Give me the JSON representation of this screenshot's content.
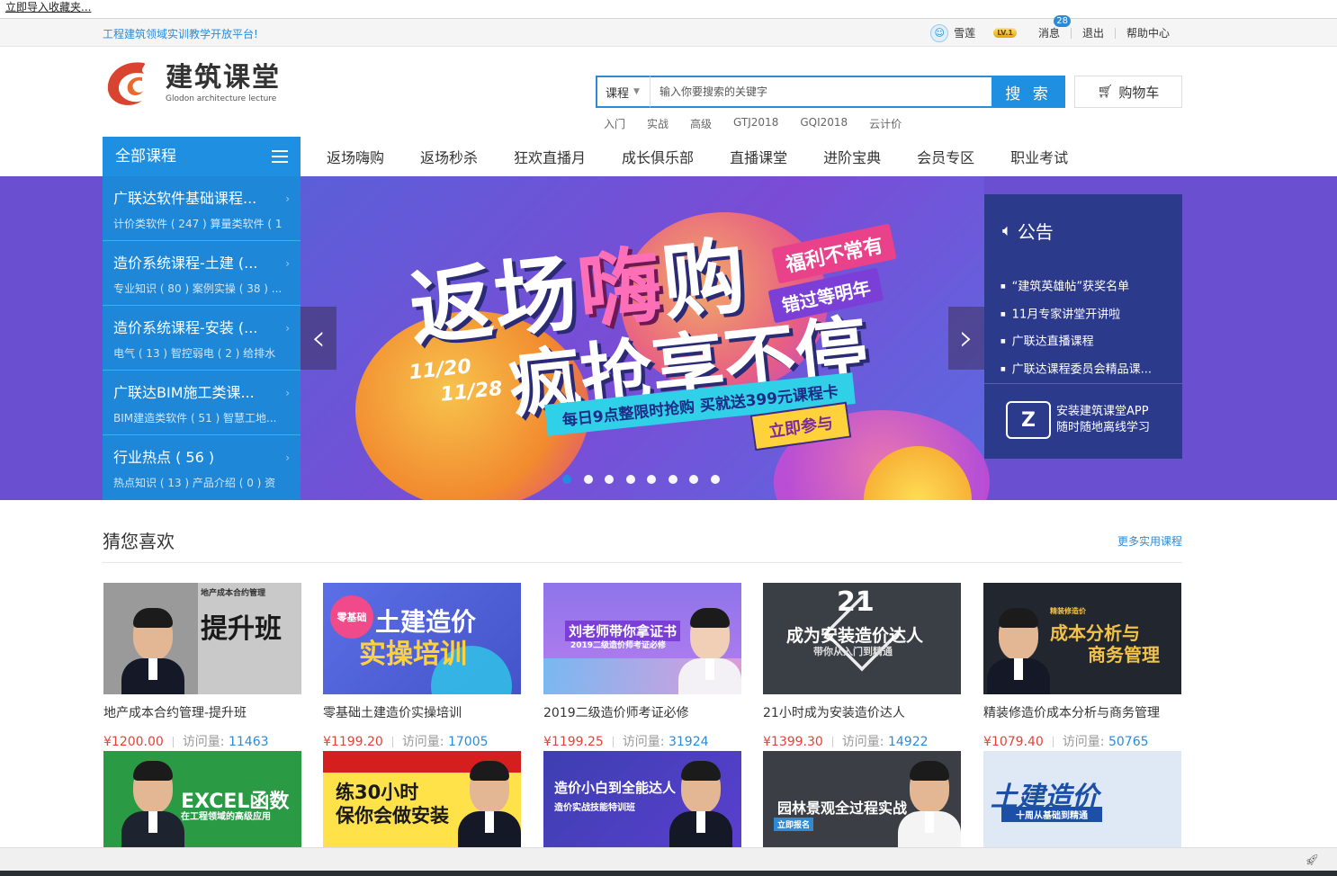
{
  "bookmark": {
    "label": "立即导入收藏夹..."
  },
  "topbar": {
    "slogan": "工程建筑领域实训教学开放平台!",
    "username": "雪莲",
    "level": "LV.1",
    "messages_label": "消息",
    "messages_count": "28",
    "logout": "退出",
    "help": "帮助中心"
  },
  "header": {
    "logo_cn": "建筑课堂",
    "logo_en": "Glodon architecture lecture",
    "search_scope": "课程",
    "search_placeholder": "输入你要搜索的关键字",
    "search_button": "搜 索",
    "cart": "购物车",
    "hotwords": [
      "入门",
      "实战",
      "高级",
      "GTJ2018",
      "GQI2018",
      "云计价"
    ]
  },
  "nav": {
    "all_courses": "全部课程",
    "items": [
      "返场嗨购",
      "返场秒杀",
      "狂欢直播月",
      "成长俱乐部",
      "直播课堂",
      "进阶宝典",
      "会员专区",
      "职业考试"
    ]
  },
  "categories": [
    {
      "title": "广联达软件基础课程...",
      "sub": "计价类软件 ( 247 )   算量类软件 ( 1"
    },
    {
      "title": "造价系统课程-土建 (...",
      "sub": "专业知识 ( 80 )   案例实操 ( 38 ) ..."
    },
    {
      "title": "造价系统课程-安装 (...",
      "sub": "电气 ( 13 )   智控弱电 ( 2 )   给排水"
    },
    {
      "title": "广联达BIM施工类课...",
      "sub": "BIM建造类软件 ( 51 )   智慧工地..."
    },
    {
      "title": "行业热点 ( 56 )",
      "sub": "热点知识 ( 13 )   产品介绍 ( 0 )   资"
    }
  ],
  "banner": {
    "line1_a": "返场",
    "line1_hi": "嗨",
    "line1_b": "购",
    "line2": "疯抢享不停",
    "date1": "11/20",
    "date2": "11/28",
    "tag1": "福利不常有",
    "tag2": "错过等明年",
    "strip": "每日9点整限时抢购  买就送399元课程卡",
    "cta": "立即参与",
    "dots": 8,
    "active_dot": 0
  },
  "notice": {
    "title": "公告",
    "items": [
      "“建筑英雄帖”获奖名单",
      "11月专家讲堂开讲啦",
      "广联达直播课程",
      "广联达课程委员会精品课..."
    ],
    "app_line1": "安装建筑课堂APP",
    "app_line2": "随时随地离线学习"
  },
  "guess": {
    "title": "猜您喜欢",
    "more": "更多实用课程",
    "price_label_visits": "访问量:",
    "courses": [
      {
        "title": "地产成本合约管理-提升班",
        "price": "¥1200.00",
        "visits": "11463",
        "thumb": "提升班",
        "thumb_sub": "地产成本合约管理",
        "bg": "#c9c9c9",
        "fg": "#1a1a1a"
      },
      {
        "title": "零基础土建造价实操培训",
        "price": "¥1199.20",
        "visits": "17005",
        "thumb": "土建造价",
        "thumb_sub": "实操培训",
        "bg": "#4e63d8",
        "fg": "#ffffff"
      },
      {
        "title": "2019二级造价师考证必修",
        "price": "¥1199.25",
        "visits": "31924",
        "thumb": "刘老师带你拿证书",
        "thumb_sub": "2019二级造价师考证必修",
        "bg": "#a06fe6",
        "fg": "#ffffff"
      },
      {
        "title": "21小时成为安装造价达人",
        "price": "¥1399.30",
        "visits": "14922",
        "thumb": "成为安装造价达人",
        "thumb_sub": "带你从入门到精通",
        "bg": "#3a3f45",
        "fg": "#ffffff"
      },
      {
        "title": "精装修造价成本分析与商务管理",
        "price": "¥1079.40",
        "visits": "50765",
        "thumb": "成本分析与",
        "thumb_sub": "商务管理",
        "bg": "#22272f",
        "fg": "#f2c14a"
      }
    ],
    "row2": [
      {
        "thumb": "EXCEL函数",
        "thumb_sub": "在工程领域的高级应用",
        "bg": "#2b9a45",
        "fg": "#ffffff"
      },
      {
        "thumb": "练30小时",
        "thumb_sub": "保你会做安装",
        "bg": "#ffe14a",
        "fg": "#1a1a1a"
      },
      {
        "thumb": "造价小白到全能达人",
        "thumb_sub": "造价实战技能特训班",
        "bg": "#3d3fb0",
        "fg": "#ffffff"
      },
      {
        "thumb": "园林景观全过程实战",
        "thumb_sub": "立即报名",
        "bg": "#3b3f45",
        "fg": "#ffffff"
      },
      {
        "thumb": "土建造价",
        "thumb_sub": "十周从基础到精通",
        "bg": "#dfe9f5",
        "fg": "#1b4fa8"
      }
    ]
  }
}
